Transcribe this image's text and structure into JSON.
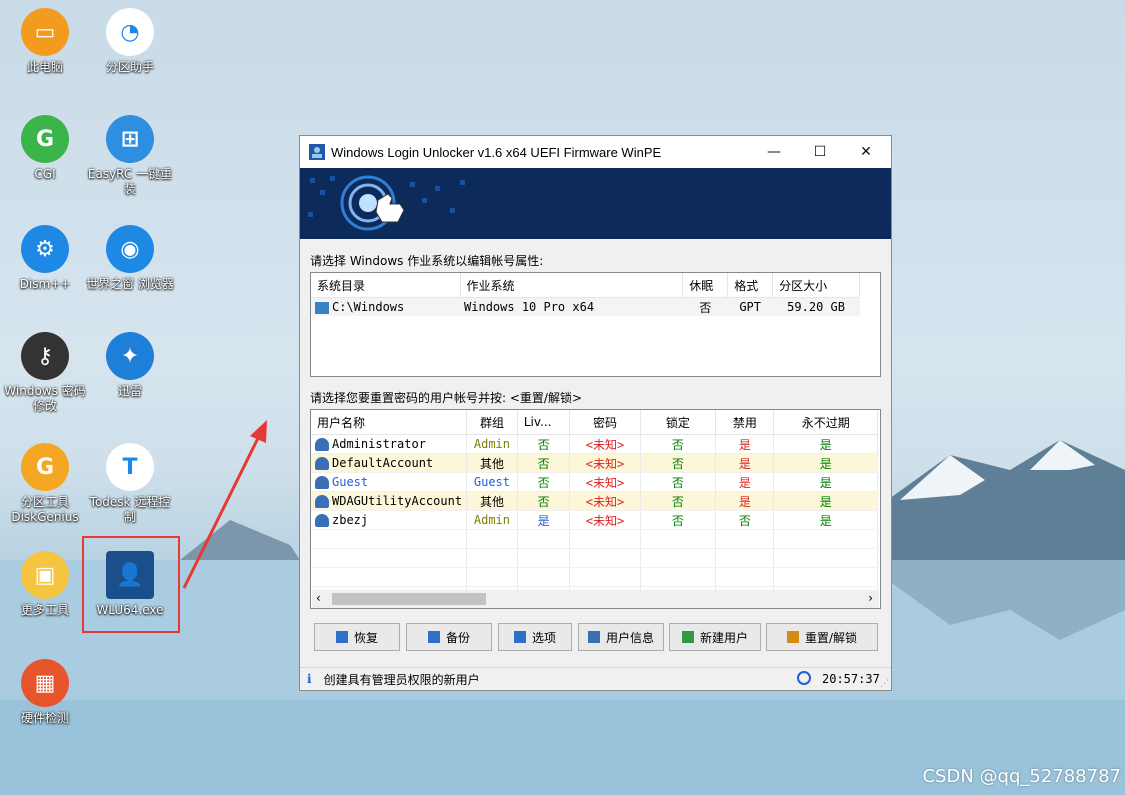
{
  "desktop": {
    "icons": [
      {
        "label": "此电脑",
        "glyph": "▭",
        "color": "#f29b1e"
      },
      {
        "label": "分区助手",
        "glyph": "◔",
        "color": "#ffffff"
      },
      {
        "label": "CGI",
        "glyph": "G",
        "color": "#3bb54a"
      },
      {
        "label": "EasyRC 一键重装",
        "glyph": "⊞",
        "color": "#2e8fe0"
      },
      {
        "label": "Dism++",
        "glyph": "⚙",
        "color": "#1e88e5"
      },
      {
        "label": "世界之窗 浏览器",
        "glyph": "◉",
        "color": "#1e88e5"
      },
      {
        "label": "Windows 密码修改",
        "glyph": "⚷",
        "color": "#333333"
      },
      {
        "label": "迅雷",
        "glyph": "✦",
        "color": "#1e7fd8"
      },
      {
        "label": "分区工具 DiskGenius",
        "glyph": "G",
        "color": "#f5a623"
      },
      {
        "label": "Todesk 远程控制",
        "glyph": "T",
        "color": "#ffffff"
      },
      {
        "label": "更多工具",
        "glyph": "▣",
        "color": "#f5c542"
      },
      {
        "label": "WLU64.exe",
        "glyph": "👤",
        "color": "#1b4f8c"
      },
      {
        "label": "硬件检测",
        "glyph": "▦",
        "color": "#e8542b"
      }
    ],
    "watermark": "CSDN @qq_52788787"
  },
  "window": {
    "title": "Windows Login Unlocker v1.6 x64  UEFI Firmware WinPE",
    "controls": {
      "minimize": "—",
      "maximize": "☐",
      "close": "✕"
    },
    "os_prompt": "请选择 Windows 作业系统以编辑帐号属性:",
    "os_table": {
      "headers": [
        "系统目录",
        "作业系统",
        "休眠",
        "格式",
        "分区大小"
      ],
      "rows": [
        [
          "C:\\Windows",
          "Windows 10 Pro x64",
          "否",
          "GPT",
          "59.20 GB"
        ]
      ]
    },
    "user_prompt": "请选择您要重置密码的用户帐号并按: <重置/解锁>",
    "user_table": {
      "headers": [
        "用户名称",
        "群组",
        "Liv...",
        "密码",
        "锁定",
        "禁用",
        "永不过期"
      ],
      "rows": [
        {
          "name": "Administrator",
          "group": "Admin",
          "live": "否",
          "password": "<未知>",
          "locked": "否",
          "disabled": "是",
          "never_expire": "是"
        },
        {
          "name": "DefaultAccount",
          "group": "其他",
          "live": "否",
          "password": "<未知>",
          "locked": "否",
          "disabled": "是",
          "never_expire": "是"
        },
        {
          "name": "Guest",
          "group": "Guest",
          "live": "否",
          "password": "<未知>",
          "locked": "否",
          "disabled": "是",
          "never_expire": "是"
        },
        {
          "name": "WDAGUtilityAccount",
          "group": "其他",
          "live": "否",
          "password": "<未知>",
          "locked": "否",
          "disabled": "是",
          "never_expire": "是"
        },
        {
          "name": "zbezj",
          "group": "Admin",
          "live": "是",
          "password": "<未知>",
          "locked": "否",
          "disabled": "否",
          "never_expire": "是"
        }
      ]
    },
    "buttons": [
      {
        "label": "恢复",
        "icon": "restore-icon"
      },
      {
        "label": "备份",
        "icon": "backup-icon"
      },
      {
        "label": "选项",
        "icon": "options-icon"
      },
      {
        "label": "用户信息",
        "icon": "user-info-icon"
      },
      {
        "label": "新建用户",
        "icon": "new-user-icon"
      },
      {
        "label": "重置/解锁",
        "icon": "reset-unlock-icon"
      }
    ],
    "status": {
      "message": "创建具有管理员权限的新用户",
      "time": "20:57:37"
    },
    "colors": {
      "red": "#e02020",
      "green": "#008000",
      "blue": "#1f5fd6",
      "admin_olive": "#808000",
      "banner": "#0c2a5a"
    }
  }
}
